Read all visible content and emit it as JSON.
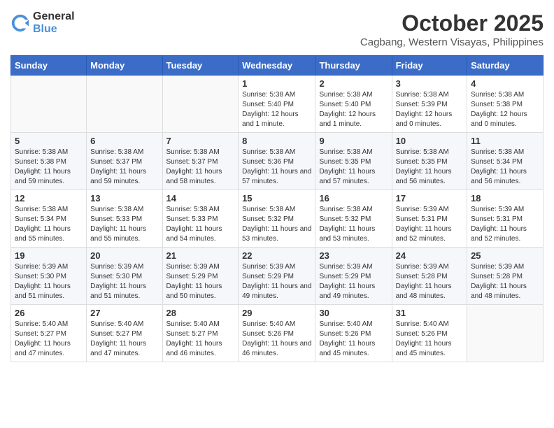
{
  "header": {
    "logo_general": "General",
    "logo_blue": "Blue",
    "title": "October 2025",
    "subtitle": "Cagbang, Western Visayas, Philippines"
  },
  "weekdays": [
    "Sunday",
    "Monday",
    "Tuesday",
    "Wednesday",
    "Thursday",
    "Friday",
    "Saturday"
  ],
  "weeks": [
    [
      {
        "day": "",
        "sunrise": "",
        "sunset": "",
        "daylight": "",
        "empty": true
      },
      {
        "day": "",
        "sunrise": "",
        "sunset": "",
        "daylight": "",
        "empty": true
      },
      {
        "day": "",
        "sunrise": "",
        "sunset": "",
        "daylight": "",
        "empty": true
      },
      {
        "day": "1",
        "sunrise": "Sunrise: 5:38 AM",
        "sunset": "Sunset: 5:40 PM",
        "daylight": "Daylight: 12 hours and 1 minute."
      },
      {
        "day": "2",
        "sunrise": "Sunrise: 5:38 AM",
        "sunset": "Sunset: 5:40 PM",
        "daylight": "Daylight: 12 hours and 1 minute."
      },
      {
        "day": "3",
        "sunrise": "Sunrise: 5:38 AM",
        "sunset": "Sunset: 5:39 PM",
        "daylight": "Daylight: 12 hours and 0 minutes."
      },
      {
        "day": "4",
        "sunrise": "Sunrise: 5:38 AM",
        "sunset": "Sunset: 5:38 PM",
        "daylight": "Daylight: 12 hours and 0 minutes."
      }
    ],
    [
      {
        "day": "5",
        "sunrise": "Sunrise: 5:38 AM",
        "sunset": "Sunset: 5:38 PM",
        "daylight": "Daylight: 11 hours and 59 minutes."
      },
      {
        "day": "6",
        "sunrise": "Sunrise: 5:38 AM",
        "sunset": "Sunset: 5:37 PM",
        "daylight": "Daylight: 11 hours and 59 minutes."
      },
      {
        "day": "7",
        "sunrise": "Sunrise: 5:38 AM",
        "sunset": "Sunset: 5:37 PM",
        "daylight": "Daylight: 11 hours and 58 minutes."
      },
      {
        "day": "8",
        "sunrise": "Sunrise: 5:38 AM",
        "sunset": "Sunset: 5:36 PM",
        "daylight": "Daylight: 11 hours and 57 minutes."
      },
      {
        "day": "9",
        "sunrise": "Sunrise: 5:38 AM",
        "sunset": "Sunset: 5:35 PM",
        "daylight": "Daylight: 11 hours and 57 minutes."
      },
      {
        "day": "10",
        "sunrise": "Sunrise: 5:38 AM",
        "sunset": "Sunset: 5:35 PM",
        "daylight": "Daylight: 11 hours and 56 minutes."
      },
      {
        "day": "11",
        "sunrise": "Sunrise: 5:38 AM",
        "sunset": "Sunset: 5:34 PM",
        "daylight": "Daylight: 11 hours and 56 minutes."
      }
    ],
    [
      {
        "day": "12",
        "sunrise": "Sunrise: 5:38 AM",
        "sunset": "Sunset: 5:34 PM",
        "daylight": "Daylight: 11 hours and 55 minutes."
      },
      {
        "day": "13",
        "sunrise": "Sunrise: 5:38 AM",
        "sunset": "Sunset: 5:33 PM",
        "daylight": "Daylight: 11 hours and 55 minutes."
      },
      {
        "day": "14",
        "sunrise": "Sunrise: 5:38 AM",
        "sunset": "Sunset: 5:33 PM",
        "daylight": "Daylight: 11 hours and 54 minutes."
      },
      {
        "day": "15",
        "sunrise": "Sunrise: 5:38 AM",
        "sunset": "Sunset: 5:32 PM",
        "daylight": "Daylight: 11 hours and 53 minutes."
      },
      {
        "day": "16",
        "sunrise": "Sunrise: 5:38 AM",
        "sunset": "Sunset: 5:32 PM",
        "daylight": "Daylight: 11 hours and 53 minutes."
      },
      {
        "day": "17",
        "sunrise": "Sunrise: 5:39 AM",
        "sunset": "Sunset: 5:31 PM",
        "daylight": "Daylight: 11 hours and 52 minutes."
      },
      {
        "day": "18",
        "sunrise": "Sunrise: 5:39 AM",
        "sunset": "Sunset: 5:31 PM",
        "daylight": "Daylight: 11 hours and 52 minutes."
      }
    ],
    [
      {
        "day": "19",
        "sunrise": "Sunrise: 5:39 AM",
        "sunset": "Sunset: 5:30 PM",
        "daylight": "Daylight: 11 hours and 51 minutes."
      },
      {
        "day": "20",
        "sunrise": "Sunrise: 5:39 AM",
        "sunset": "Sunset: 5:30 PM",
        "daylight": "Daylight: 11 hours and 51 minutes."
      },
      {
        "day": "21",
        "sunrise": "Sunrise: 5:39 AM",
        "sunset": "Sunset: 5:29 PM",
        "daylight": "Daylight: 11 hours and 50 minutes."
      },
      {
        "day": "22",
        "sunrise": "Sunrise: 5:39 AM",
        "sunset": "Sunset: 5:29 PM",
        "daylight": "Daylight: 11 hours and 49 minutes."
      },
      {
        "day": "23",
        "sunrise": "Sunrise: 5:39 AM",
        "sunset": "Sunset: 5:29 PM",
        "daylight": "Daylight: 11 hours and 49 minutes."
      },
      {
        "day": "24",
        "sunrise": "Sunrise: 5:39 AM",
        "sunset": "Sunset: 5:28 PM",
        "daylight": "Daylight: 11 hours and 48 minutes."
      },
      {
        "day": "25",
        "sunrise": "Sunrise: 5:39 AM",
        "sunset": "Sunset: 5:28 PM",
        "daylight": "Daylight: 11 hours and 48 minutes."
      }
    ],
    [
      {
        "day": "26",
        "sunrise": "Sunrise: 5:40 AM",
        "sunset": "Sunset: 5:27 PM",
        "daylight": "Daylight: 11 hours and 47 minutes."
      },
      {
        "day": "27",
        "sunrise": "Sunrise: 5:40 AM",
        "sunset": "Sunset: 5:27 PM",
        "daylight": "Daylight: 11 hours and 47 minutes."
      },
      {
        "day": "28",
        "sunrise": "Sunrise: 5:40 AM",
        "sunset": "Sunset: 5:27 PM",
        "daylight": "Daylight: 11 hours and 46 minutes."
      },
      {
        "day": "29",
        "sunrise": "Sunrise: 5:40 AM",
        "sunset": "Sunset: 5:26 PM",
        "daylight": "Daylight: 11 hours and 46 minutes."
      },
      {
        "day": "30",
        "sunrise": "Sunrise: 5:40 AM",
        "sunset": "Sunset: 5:26 PM",
        "daylight": "Daylight: 11 hours and 45 minutes."
      },
      {
        "day": "31",
        "sunrise": "Sunrise: 5:40 AM",
        "sunset": "Sunset: 5:26 PM",
        "daylight": "Daylight: 11 hours and 45 minutes."
      },
      {
        "day": "",
        "sunrise": "",
        "sunset": "",
        "daylight": "",
        "empty": true
      }
    ]
  ]
}
